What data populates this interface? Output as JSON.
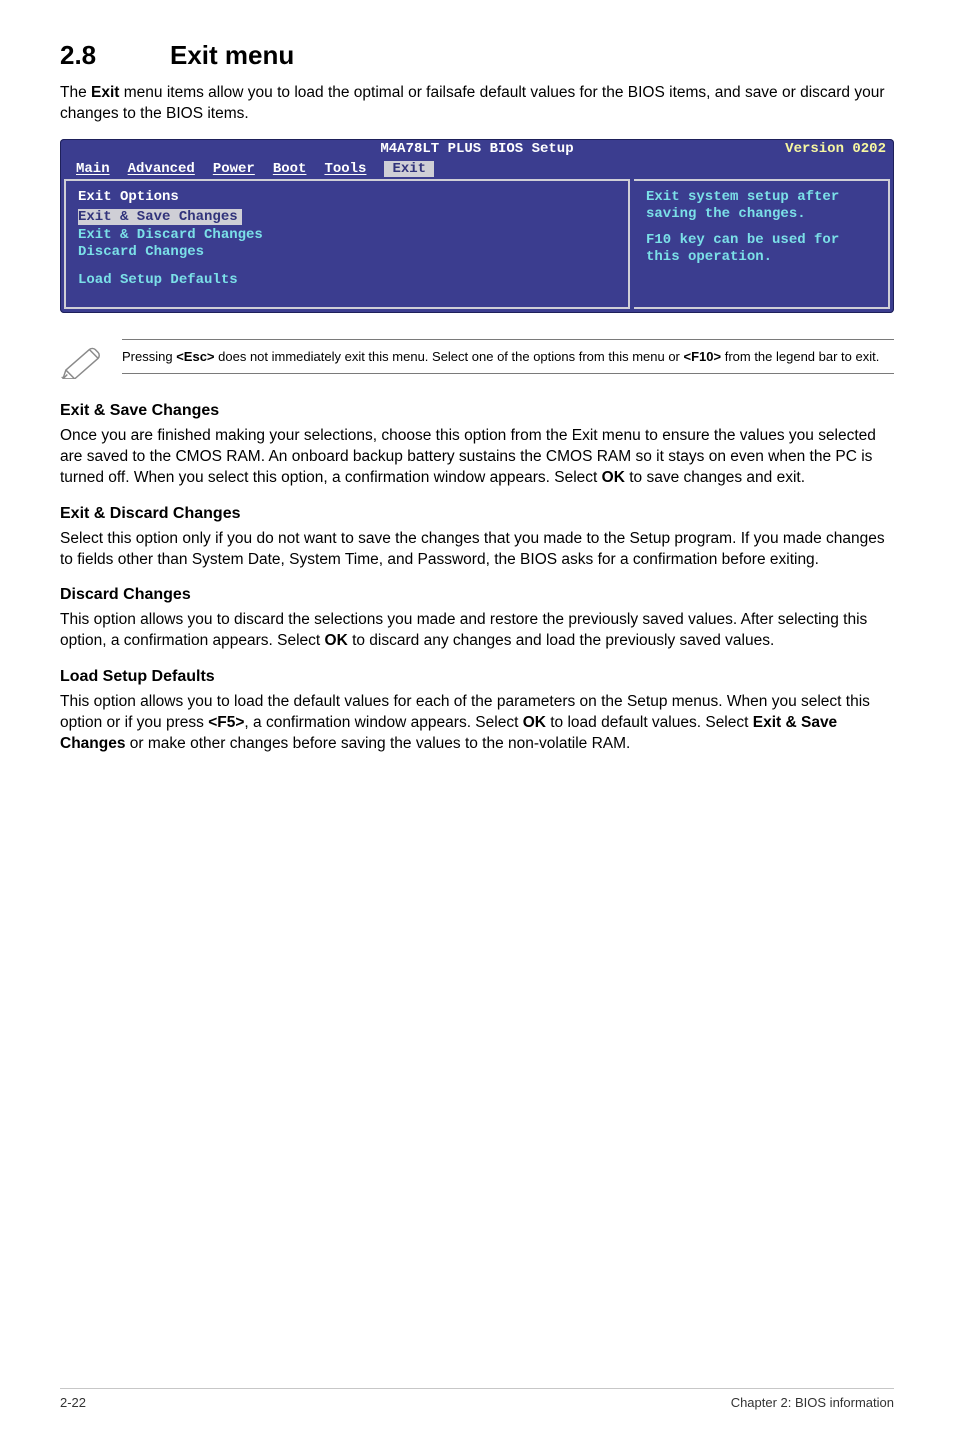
{
  "section": {
    "number": "2.8",
    "title": "Exit menu",
    "intro_pre": "The ",
    "intro_bold": "Exit",
    "intro_post": " menu items allow you to load the optimal or failsafe default values for the BIOS items, and save or discard your changes to the BIOS items."
  },
  "bios": {
    "title": "M4A78LT PLUS BIOS Setup",
    "version": "Version 0202",
    "tabs": {
      "main": "Main",
      "advanced": "Advanced",
      "power": "Power",
      "boot": "Boot",
      "tools": "Tools",
      "exit": "Exit"
    },
    "main_panel": {
      "heading": "Exit Options",
      "items": {
        "save": "Exit & Save Changes",
        "discard_exit": "Exit & Discard Changes",
        "discard": "Discard Changes",
        "load_defaults": "Load Setup Defaults"
      }
    },
    "side_panel": {
      "line1": "Exit system setup after saving the changes.",
      "line2": "F10 key can be used for this operation."
    }
  },
  "note": {
    "text_pre": "Pressing ",
    "esc": "<Esc>",
    "text_mid": " does not immediately exit this menu. Select one of the options from this menu or ",
    "f10": "<F10>",
    "text_post": " from the legend bar to exit."
  },
  "subsections": {
    "save": {
      "title": "Exit & Save Changes",
      "body_pre": "Once you are finished making your selections, choose this option from the Exit menu to ensure the values you selected are saved to the CMOS RAM. An onboard backup battery sustains the CMOS RAM so it stays on even when the PC is turned off. When you select this option, a confirmation window appears. Select ",
      "body_bold": "OK",
      "body_post": " to save changes and exit."
    },
    "discard_exit": {
      "title": "Exit & Discard Changes",
      "body": "Select this option only if you do not want to save the changes that you made to the Setup program. If you made changes to fields other than System Date, System Time, and Password, the BIOS asks for a confirmation before exiting."
    },
    "discard": {
      "title": "Discard Changes",
      "body_pre": "This option allows you to discard the selections you made and restore the previously saved values. After selecting this option, a confirmation appears. Select ",
      "body_bold": "OK",
      "body_post": " to discard any changes and load the previously saved values."
    },
    "load": {
      "title": "Load Setup Defaults",
      "body_1": "This option allows you to load the default values for each of the parameters on the Setup menus. When you select this option or if you press ",
      "f5": "<F5>",
      "body_2": ", a confirmation window appears. Select ",
      "ok1": "OK",
      "body_3": " to load default values. Select ",
      "esc_label": "Exit & Save Changes",
      "body_4": " or make other changes before saving the values to the non-volatile RAM."
    }
  },
  "footer": {
    "left": "2-22",
    "right": "Chapter 2: BIOS information"
  }
}
